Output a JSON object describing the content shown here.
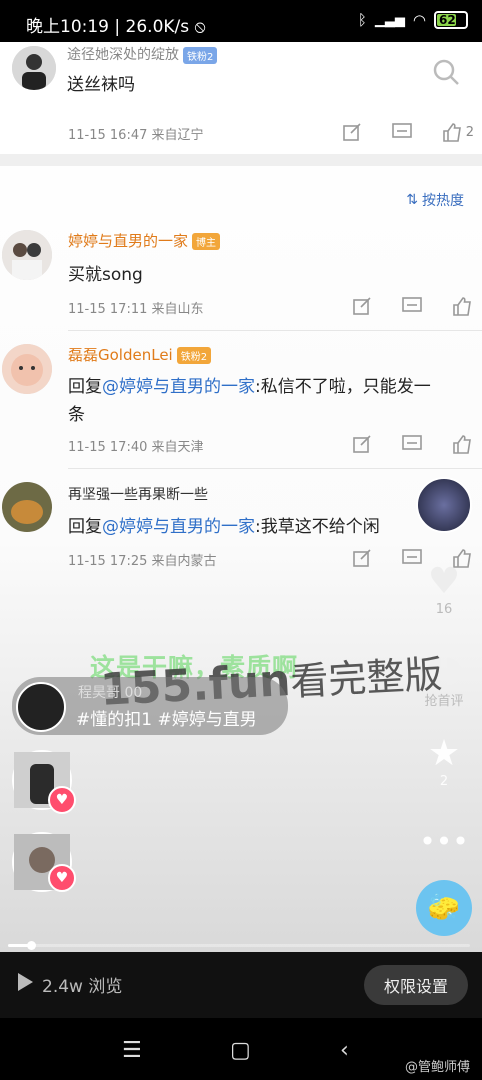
{
  "status_bar": {
    "time": "晚上10:19",
    "speed": "26.0K/s",
    "battery": "62",
    "battery_color": "#8bd34a"
  },
  "top_comment": {
    "user": "途径她深处的绽放",
    "badge": "铁粉2",
    "text": "送丝袜吗",
    "meta": "11-15 16:47  来自辽宁",
    "likes": "2"
  },
  "sort_label": "按热度",
  "comments": [
    {
      "user": "婷婷与直男的一家",
      "badge": "博主",
      "text": "买就song",
      "meta": "11-15 17:11  来自山东"
    },
    {
      "user": "磊磊GoldenLei",
      "badge": "铁粉2",
      "reply_prefix": "回复",
      "reply_to": "@婷婷与直男的一家",
      "text_line1": ":私信不了啦，只能发一",
      "text_line2": "条",
      "meta": "11-15 17:40  来自天津"
    },
    {
      "user": "再坚强一些再果断一些",
      "reply_prefix": "回复",
      "reply_to": "@婷婷与直男的一家",
      "text_line1": ":我草这不给个闲",
      "meta": "11-15 17:25  来自内蒙古"
    }
  ],
  "video": {
    "caption_green": "这是干嘛，素质啊",
    "watermark_brand": "155.fun",
    "watermark_text": "看完整版",
    "author": "程昊哥",
    "author_suffix": "00",
    "tags": "#懂的扣1 #婷婷与直男",
    "like_count": "16",
    "comment_label": "抢首评",
    "star_count": "2",
    "progress_pct": 5
  },
  "bottom_bar": {
    "views": "2.4w 浏览",
    "perm_button": "权限设置"
  },
  "credit": "@管鲍师傅",
  "accent_colors": {
    "name_orange": "#e07b1a",
    "link_blue": "#2f6fc8",
    "heart_pink": "#ff4d6d"
  }
}
